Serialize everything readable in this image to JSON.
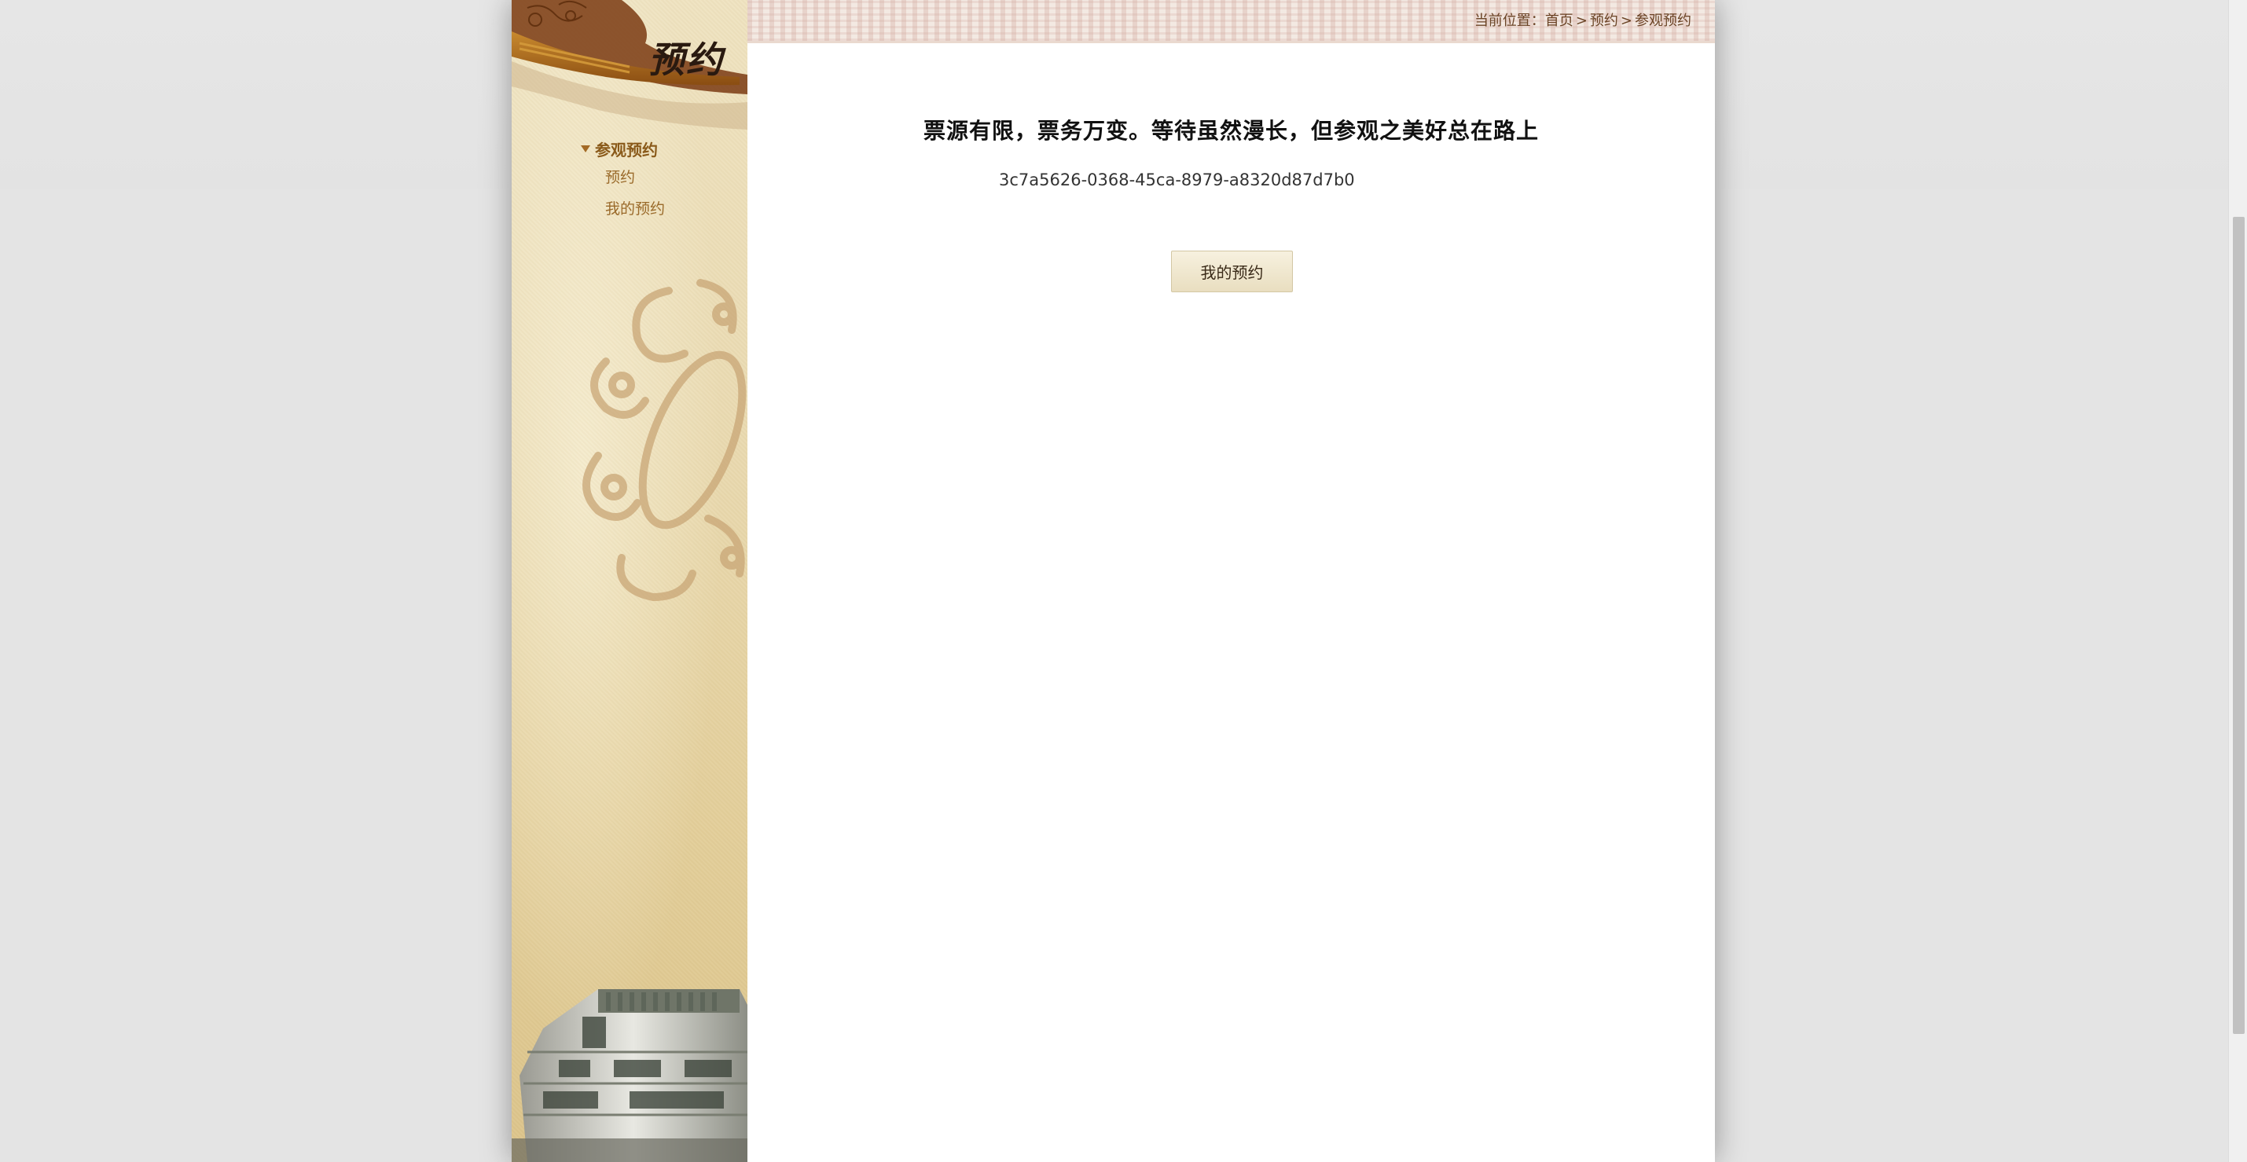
{
  "sidebar": {
    "title": "预约",
    "nav": {
      "section_label": "参观预约",
      "items": [
        {
          "label": "预约"
        },
        {
          "label": "我的预约"
        }
      ]
    }
  },
  "breadcrumb": {
    "prefix": "当前位置：",
    "items": [
      "首页",
      "预约",
      "参观预约"
    ],
    "separator": ">"
  },
  "main": {
    "headline": "票源有限，票务万变。等待虽然漫长，但参观之美好总在路上",
    "reservation_id": "3c7a5626-0368-45ca-8979-a8320d87d7b0",
    "my_booking_button": "我的预约"
  },
  "colors": {
    "page_background": "#e4e4e4",
    "sidebar_gold": "#e3cf9b",
    "nav_brown": "#8a5a1a",
    "button_bg": "#efe6cc"
  },
  "icons": {
    "nav_caret": "caret-down-icon",
    "roof": "palace-roof-ornament",
    "scroll": "floral-scroll-ornament",
    "building": "museum-building-image"
  }
}
